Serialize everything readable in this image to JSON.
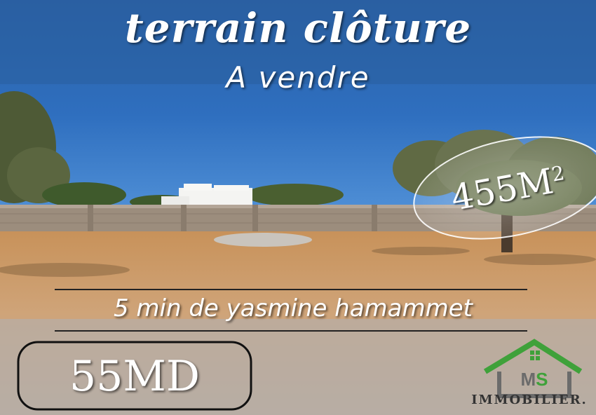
{
  "title_line1": "terrain clôture",
  "title_line2": "A vendre",
  "area": {
    "value": "455M",
    "exponent": "2"
  },
  "distance": "5 min de yasmine hamammet",
  "price": "55MD",
  "logo": {
    "letters": "MS",
    "wordmark": "IMMOBILIER."
  },
  "colors": {
    "sky": "#2c6cb8",
    "ground": "#c99a62",
    "logo_green": "#3fa13a",
    "logo_grey": "#6b6b6b"
  }
}
